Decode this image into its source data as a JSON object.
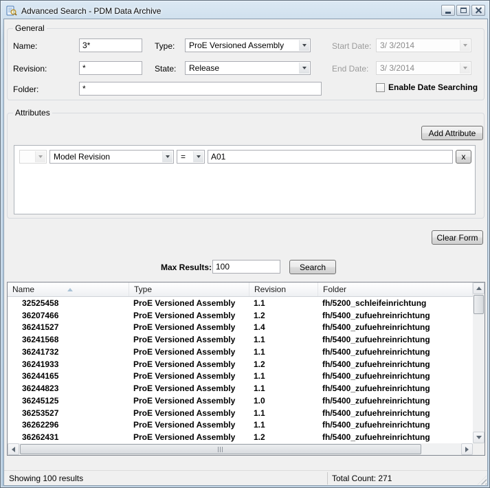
{
  "window": {
    "title": "Advanced Search - PDM Data Archive"
  },
  "general": {
    "legend": "General",
    "fields": {
      "name": {
        "label": "Name:",
        "value": "3*"
      },
      "type": {
        "label": "Type:",
        "value": "ProE Versioned Assembly"
      },
      "start_date": {
        "label": "Start Date:",
        "value": "3/ 3/2014"
      },
      "revision": {
        "label": "Revision:",
        "value": "*"
      },
      "state": {
        "label": "State:",
        "value": "Release"
      },
      "end_date": {
        "label": "End Date:",
        "value": "3/ 3/2014"
      },
      "folder": {
        "label": "Folder:",
        "value": "*"
      }
    },
    "enable_date_checkbox_label": "Enable Date Searching"
  },
  "attributes": {
    "legend": "Attributes",
    "add_attribute_button": "Add Attribute",
    "row": {
      "attribute": "Model Revision",
      "operator": "=",
      "value": "A01",
      "remove_button": "x"
    }
  },
  "actions": {
    "clear_form_button": "Clear Form",
    "max_results_label": "Max Results:",
    "max_results_value": "100",
    "search_button": "Search"
  },
  "results": {
    "columns": [
      "Name",
      "Type",
      "Revision",
      "Folder"
    ],
    "sort": {
      "column": "Name",
      "direction": "ascending"
    },
    "rows": [
      [
        "32525458",
        "ProE Versioned Assembly",
        "1.1",
        "fh/5200_schleifeinrichtung"
      ],
      [
        "36207466",
        "ProE Versioned Assembly",
        "1.2",
        "fh/5400_zufuehreinrichtung"
      ],
      [
        "36241527",
        "ProE Versioned Assembly",
        "1.4",
        "fh/5400_zufuehreinrichtung"
      ],
      [
        "36241568",
        "ProE Versioned Assembly",
        "1.1",
        "fh/5400_zufuehreinrichtung"
      ],
      [
        "36241732",
        "ProE Versioned Assembly",
        "1.1",
        "fh/5400_zufuehreinrichtung"
      ],
      [
        "36241933",
        "ProE Versioned Assembly",
        "1.2",
        "fh/5400_zufuehreinrichtung"
      ],
      [
        "36244165",
        "ProE Versioned Assembly",
        "1.1",
        "fh/5400_zufuehreinrichtung"
      ],
      [
        "36244823",
        "ProE Versioned Assembly",
        "1.1",
        "fh/5400_zufuehreinrichtung"
      ],
      [
        "36245125",
        "ProE Versioned Assembly",
        "1.0",
        "fh/5400_zufuehreinrichtung"
      ],
      [
        "36253527",
        "ProE Versioned Assembly",
        "1.1",
        "fh/5400_zufuehreinrichtung"
      ],
      [
        "36262296",
        "ProE Versioned Assembly",
        "1.1",
        "fh/5400_zufuehreinrichtung"
      ],
      [
        "36262431",
        "ProE Versioned Assembly",
        "1.2",
        "fh/5400_zufuehreinrichtung"
      ]
    ]
  },
  "statusbar": {
    "results_text": "Showing 100 results",
    "total_count_text": "Total Count: 271"
  }
}
